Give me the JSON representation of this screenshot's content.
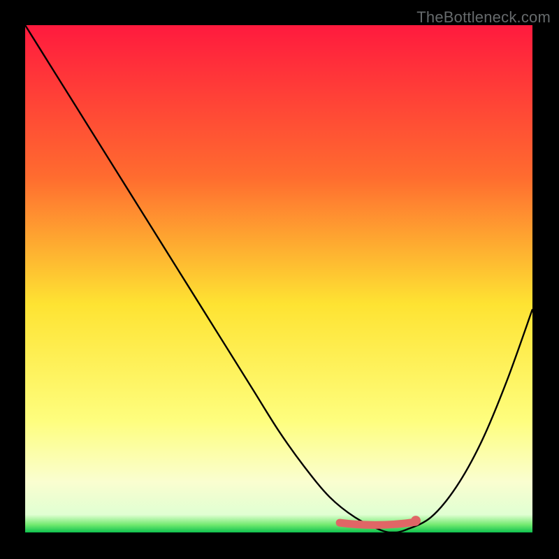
{
  "watermark": "TheBottleneck.com",
  "colors": {
    "background": "#000000",
    "gradient_stops": [
      {
        "offset": 0.0,
        "color": "#ff1a3e"
      },
      {
        "offset": 0.3,
        "color": "#ff6c2f"
      },
      {
        "offset": 0.55,
        "color": "#fee332"
      },
      {
        "offset": 0.78,
        "color": "#fefe7e"
      },
      {
        "offset": 0.9,
        "color": "#fafed0"
      },
      {
        "offset": 0.965,
        "color": "#e0ffd2"
      },
      {
        "offset": 0.985,
        "color": "#71e96f"
      },
      {
        "offset": 1.0,
        "color": "#0fc24e"
      }
    ],
    "curve": "#000000",
    "marker": "#e06666"
  },
  "chart_data": {
    "type": "line",
    "title": "",
    "xlabel": "",
    "ylabel": "",
    "xlim": [
      0,
      1
    ],
    "ylim": [
      0,
      1
    ],
    "series": [
      {
        "name": "bottleneck-curve",
        "x": [
          0.0,
          0.05,
          0.1,
          0.15,
          0.2,
          0.25,
          0.3,
          0.35,
          0.4,
          0.45,
          0.5,
          0.55,
          0.6,
          0.65,
          0.7,
          0.725,
          0.75,
          0.8,
          0.85,
          0.9,
          0.95,
          1.0
        ],
        "y": [
          1.0,
          0.92,
          0.84,
          0.76,
          0.68,
          0.6,
          0.52,
          0.44,
          0.36,
          0.28,
          0.2,
          0.13,
          0.07,
          0.03,
          0.005,
          0.0,
          0.005,
          0.03,
          0.09,
          0.18,
          0.3,
          0.44
        ]
      }
    ],
    "marker_band": {
      "x_start": 0.62,
      "x_end": 0.77,
      "y": 0.015
    }
  }
}
